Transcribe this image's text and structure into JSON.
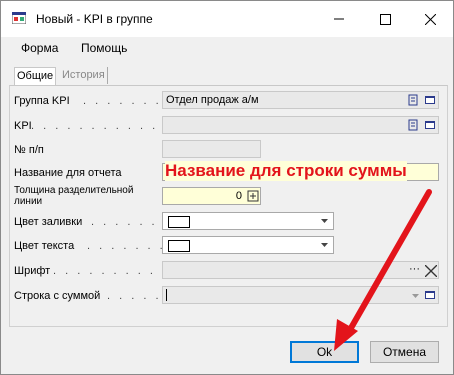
{
  "window": {
    "title": "Новый - KPI в группе"
  },
  "menu": [
    "Форма",
    "Помощь"
  ],
  "tabs": [
    "Общие",
    "История"
  ],
  "fields": {
    "group_kpi": {
      "label": "Группа KPI",
      "value": "Отдел продаж а/м"
    },
    "kpi": {
      "label": "KPI",
      "value": ""
    },
    "number": {
      "label": "№ п/п",
      "value": ""
    },
    "report_name": {
      "label": "Название для отчета",
      "value": ""
    },
    "separator_width": {
      "label_line1": "Толщина разделительной",
      "label_line2": "линии",
      "value": "0"
    },
    "fill_color": {
      "label": "Цвет заливки"
    },
    "text_color": {
      "label": "Цвет текста"
    },
    "font": {
      "label": "Шрифт",
      "value": ""
    },
    "sum_row": {
      "label": "Строка с суммой",
      "value": ""
    }
  },
  "annotation": {
    "text": "Название для строки суммы",
    "color": "#e3141b"
  },
  "buttons": {
    "ok": "Ok",
    "cancel": "Отмена"
  },
  "colors": {
    "accent": "#0078d7",
    "arrow": "#e3141b",
    "field_icon": "#2b3a8c"
  }
}
